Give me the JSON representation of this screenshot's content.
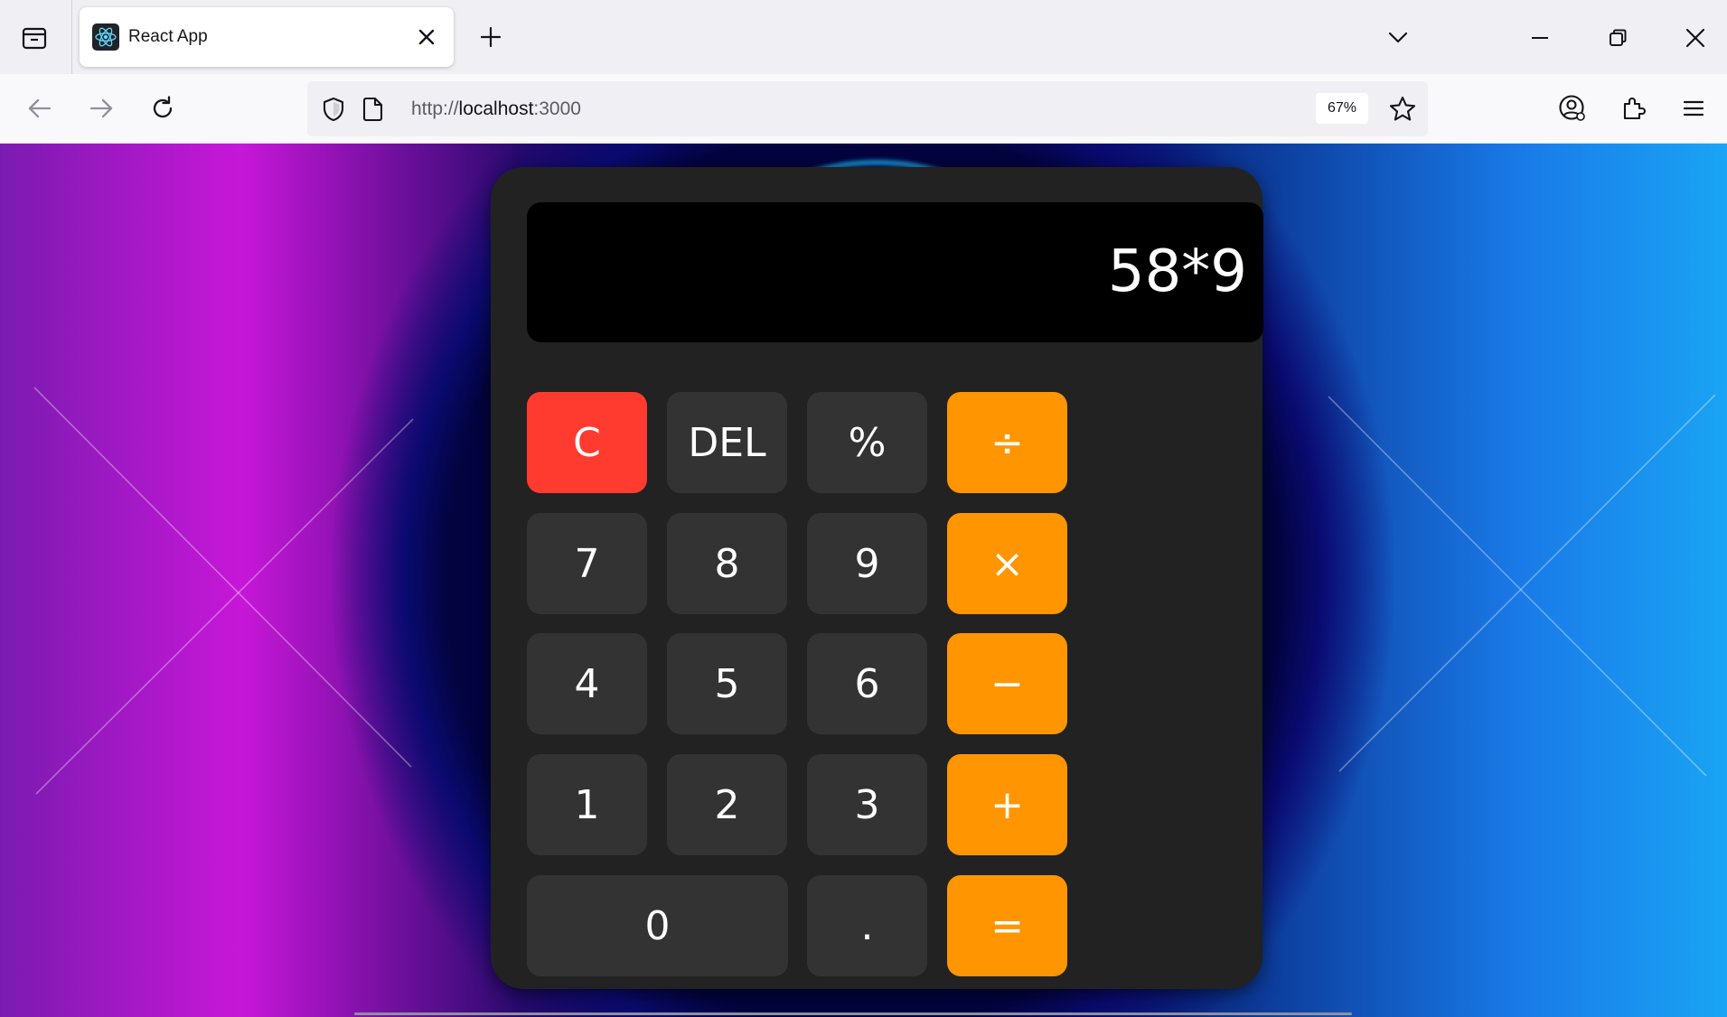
{
  "browser": {
    "tab_title": "React App",
    "url_scheme": "http://",
    "url_host": "localhost",
    "url_port": ":3000",
    "zoom": "67%"
  },
  "calculator": {
    "display": "58*9",
    "keys": {
      "clear": "C",
      "del": "DEL",
      "percent": "%",
      "divide": "÷",
      "seven": "7",
      "eight": "8",
      "nine": "9",
      "multiply": "×",
      "four": "4",
      "five": "5",
      "six": "6",
      "minus": "−",
      "one": "1",
      "two": "2",
      "three": "3",
      "plus": "+",
      "zero": "0",
      "decimal": ".",
      "equals": "="
    },
    "colors": {
      "body": "#222222",
      "display": "#000000",
      "digit_key": "#333333",
      "clear_key": "#ff3b30",
      "operator_key": "#ff9500"
    }
  }
}
